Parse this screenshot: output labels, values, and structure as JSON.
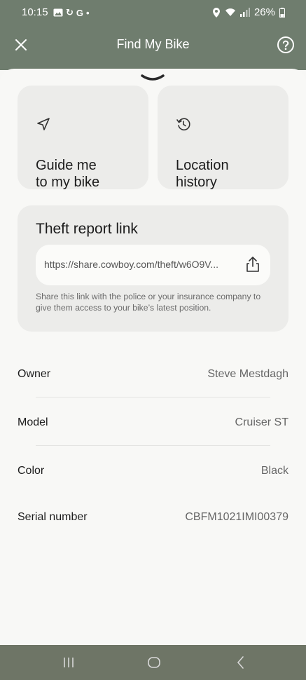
{
  "status_bar": {
    "time": "10:15",
    "battery": "26%"
  },
  "header": {
    "title": "Find My Bike",
    "close_icon": "close-icon",
    "help_icon": "help-icon"
  },
  "actions": [
    {
      "label": "Guide me\nto my bike",
      "icon": "navigation-arrow-icon"
    },
    {
      "label": "Location\nhistory",
      "icon": "history-icon"
    }
  ],
  "theft": {
    "title": "Theft report link",
    "url": "https://share.cowboy.com/theft/w6O9V...",
    "description": "Share this link with the police or your insurance company to give them access to your bike’s latest position.",
    "share_icon": "share-icon"
  },
  "details": [
    {
      "label": "Owner",
      "value": "Steve Mestdagh"
    },
    {
      "label": "Model",
      "value": "Cruiser ST"
    },
    {
      "label": "Color",
      "value": "Black"
    },
    {
      "label": "Serial number",
      "value": "CBFM1021IMI00379"
    }
  ],
  "colors": {
    "header_bg": "#6f7d6e",
    "sheet_bg": "#f8f8f6",
    "card_bg": "#ececea"
  }
}
